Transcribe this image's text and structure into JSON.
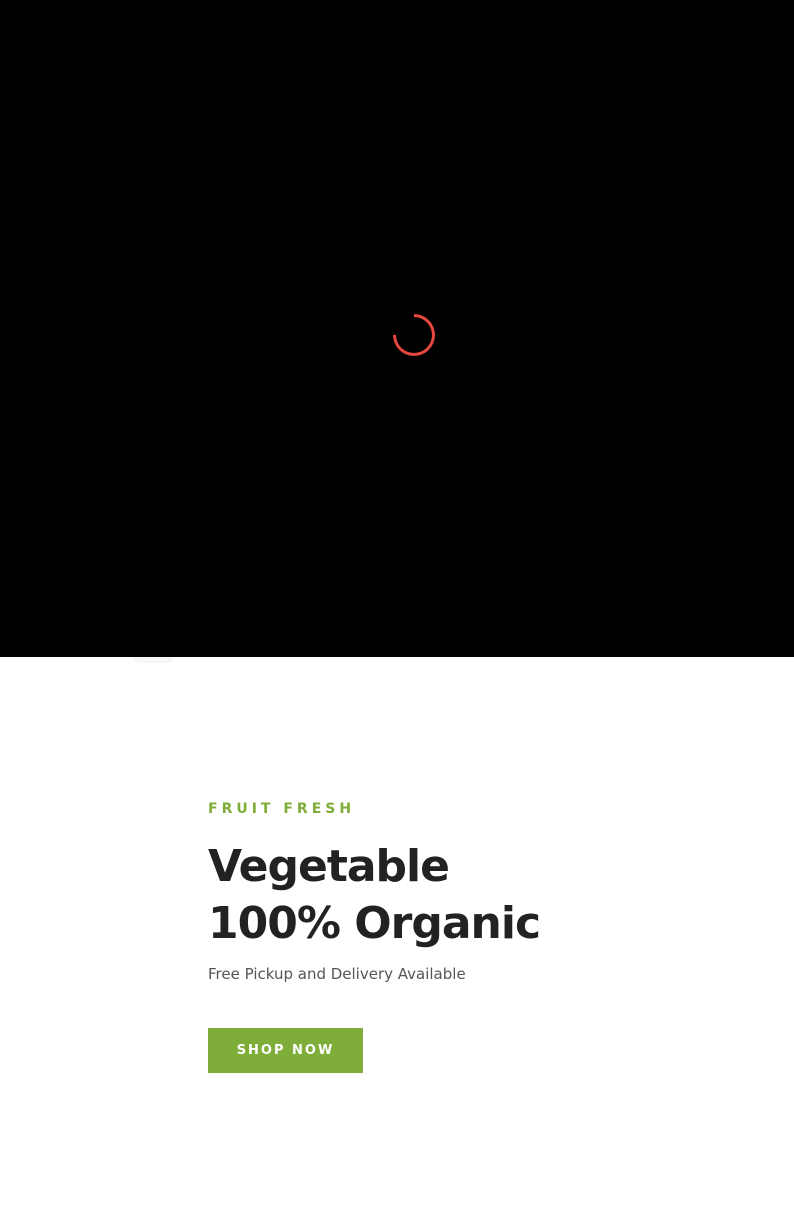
{
  "preloader": {
    "background": "#000000",
    "spinner_color": "#e8473f",
    "spinner_icon": "loading-spinner-icon"
  },
  "hero": {
    "eyebrow": "FRUIT FRESH",
    "eyebrow_color": "#7fad39",
    "headline_line1": "Vegetable",
    "headline_line2": "100% Organic",
    "subtext": "Free Pickup and Delivery Available",
    "cta_label": "SHOP NOW",
    "cta_color": "#7fad39"
  }
}
